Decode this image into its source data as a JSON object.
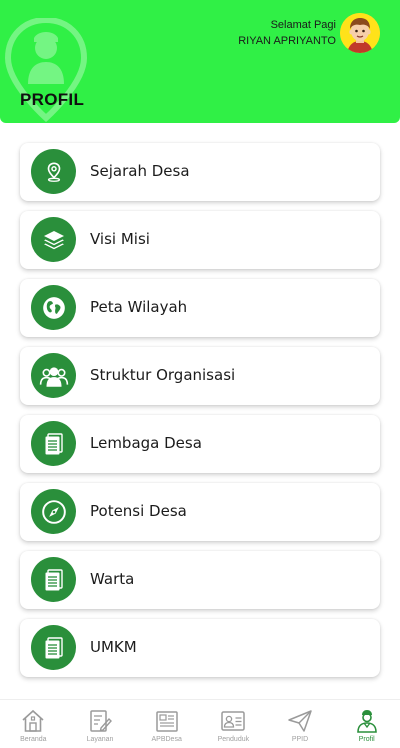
{
  "header": {
    "title": "PROFIL",
    "greeting": "Selamat Pagi",
    "user_name": "RIYAN APRIYANTO",
    "accent_color": "#30f046"
  },
  "menu": {
    "icon_color": "#2a8f3b",
    "items": [
      {
        "label": "Sejarah Desa",
        "icon": "location-pin-icon"
      },
      {
        "label": "Visi Misi",
        "icon": "layers-icon"
      },
      {
        "label": "Peta Wilayah",
        "icon": "globe-map-icon"
      },
      {
        "label": "Struktur Organisasi",
        "icon": "group-icon"
      },
      {
        "label": "Lembaga Desa",
        "icon": "document-icon"
      },
      {
        "label": "Potensi Desa",
        "icon": "compass-icon"
      },
      {
        "label": "Warta",
        "icon": "document-icon"
      },
      {
        "label": "UMKM",
        "icon": "document-icon"
      }
    ]
  },
  "bottom_nav": {
    "items": [
      {
        "label": "Beranda",
        "icon": "home-icon"
      },
      {
        "label": "Layanan",
        "icon": "edit-document-icon"
      },
      {
        "label": "APBDesa",
        "icon": "newspaper-icon"
      },
      {
        "label": "Penduduk",
        "icon": "id-card-icon"
      },
      {
        "label": "PPID",
        "icon": "paper-plane-icon"
      },
      {
        "label": "Profil",
        "icon": "profile-user-icon"
      }
    ],
    "active": "Profil"
  }
}
